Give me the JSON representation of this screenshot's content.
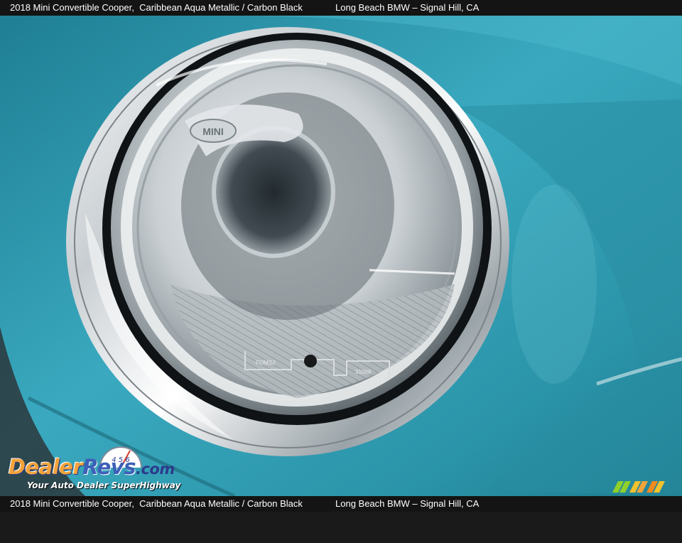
{
  "caption": {
    "left": "2018 Mini Convertible Cooper,  Caribbean Aqua Metallic / Carbon Black",
    "right": "Long Beach BMW – Signal Hill, CA"
  },
  "photo": {
    "subject": "headlight",
    "paint_color": "#2f9bb0",
    "chrome_color": "#d9dde0",
    "lens_markings": [
      "FOMSJ",
      "31069"
    ],
    "badge": "MINI"
  },
  "watermark": {
    "brand_part1": "Dealer",
    "brand_part2": "Revs",
    "brand_part3": ".com",
    "tagline": "Your Auto Dealer SuperHighway",
    "gauge_digits": "4 5 6"
  },
  "colors": {
    "logo_orange": "#f2a33a",
    "logo_blue": "#3c5fb8",
    "stripe_colors": [
      "#8fd12a",
      "#f2c12e",
      "#f28a1e"
    ]
  }
}
